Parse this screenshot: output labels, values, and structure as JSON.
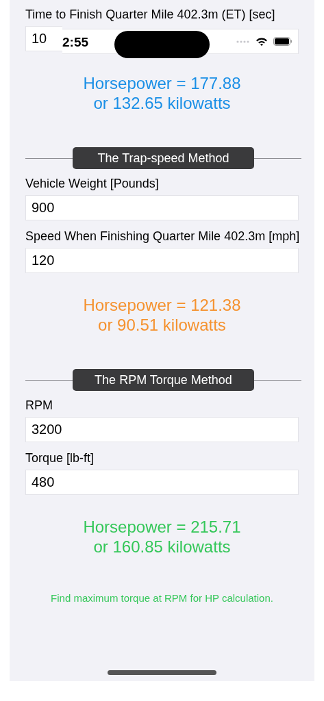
{
  "status_bar": {
    "time": "2:55"
  },
  "sections": [
    {
      "fields": [
        {
          "label": "Time to Finish Quarter Mile 402.3m (ET) [sec]",
          "value": "10"
        }
      ],
      "result": {
        "lines": [
          "Horsepower = 177.88",
          "or 132.65 kilowatts"
        ],
        "color": "#1a8fe6"
      }
    },
    {
      "heading": "The Trap-speed Method",
      "fields": [
        {
          "label": "Vehicle Weight [Pounds]",
          "value": "900"
        },
        {
          "label": "Speed When Finishing Quarter Mile 402.3m [mph]",
          "value": "120"
        }
      ],
      "result": {
        "lines": [
          "Horsepower = 121.38",
          "or 90.51 kilowatts"
        ],
        "color": "#f5922f"
      }
    },
    {
      "heading": "The RPM Torque Method",
      "fields": [
        {
          "label": "RPM",
          "value": "3200"
        },
        {
          "label": "Torque [lb-ft]",
          "value": "480"
        }
      ],
      "result": {
        "lines": [
          "Horsepower = 215.71",
          "or 160.85 kilowatts"
        ],
        "color": "#34c759"
      }
    }
  ],
  "footnote": {
    "text": "Find maximum torque at RPM for HP calculation.",
    "color": "#34c759"
  }
}
